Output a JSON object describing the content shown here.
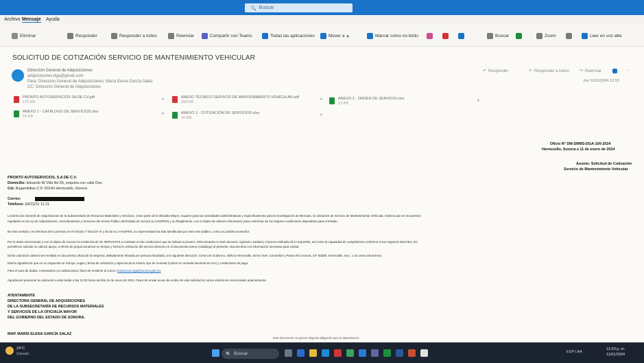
{
  "search": {
    "placeholder": "Buscar"
  },
  "menu": {
    "items": [
      "Archivo",
      "Mensaje",
      "Ayuda"
    ]
  },
  "toolbar": {
    "buttons": [
      "Eliminar",
      "Responder",
      "Responder a todos",
      "Reenviar",
      "Compartir con Teams",
      "Todas las aplicaciones",
      "Mover a",
      "Marcar como no leído",
      "Buscar",
      "Zoom",
      "Leer en voz alta"
    ]
  },
  "message": {
    "subject": "SOLICITUD DE COTIZACIÓN SERVICIO DE MANTENIMIENTO VEHICULAR",
    "from": "Dirección General de Adquisiciones",
    "from_email": "adquisiciones.dga@gmail.com",
    "to_line": "Para: Dirección General de Adquisiciones; María Elena García Salaz",
    "cc_line": "CC: Dirección General de Adquisiciones",
    "actions": [
      "Responder",
      "Responder a todos",
      "Reenviar"
    ],
    "date": "Jue 11/01/2024 12:53"
  },
  "attachments": [
    {
      "name": "PRONTO AUTOSERVICIOS SA DE CV.pdf",
      "size": "170 KB",
      "color": "#d13438"
    },
    {
      "name": "ANEXO TÉCNICO SERVICIO DE MANTENIMIENTO VEHICULAR.pdf",
      "size": "293 KB",
      "color": "#d13438"
    },
    {
      "name": "ANEXO 2 - ORDEN DE SERVICIO.xlsx",
      "size": "13 KB",
      "color": "#1e8e3e"
    },
    {
      "name": "ANEXO 1 - CATÁLOGO DE SERVICIOS.xlsx",
      "size": "15 KB",
      "color": "#1e8e3e"
    },
    {
      "name": "ANEXO 3 - COTIZACIÓN DE SERVICIOS.xlsx",
      "size": "16 KB",
      "color": "#1e8e3e"
    }
  ],
  "letter": {
    "oficio": "Oficio N° DM-SRMS-DGA-100-2024",
    "lugar_fecha": "Hermosillo, Sonora a 11 de enero de 2024",
    "asunto_1": "Asunto: Solicitud de Cotización",
    "asunto_2": "Servicio de Mantenimiento Vehicular",
    "company": "PRONTO AUTOSERVICIOS, S.A DE C.V.",
    "domicilio_label": "Domicilio:",
    "domicilio": "Eduardo W Villa No 55, esquina con calle Dos",
    "colonia_label": "Col.",
    "colonia": "Bugambilias C.P. 83140 Hermosillo, Sonora",
    "correo_label": "Correo:",
    "telefono_label": "Teléfono:",
    "telefono": "(662)211 11 21",
    "p1": "La Dirección General de Adquisiciones de la Subsecretaría de Recursos Materiales y Servicios, como parte de la Oficialía Mayor, requiere para sus actividades administrativas y específicamente para la Investigación de Mercado, la cotización de Servicio de Mantenimiento Vehicular, mismos que se encuentran",
    "p1b": "regulados en la Ley de Adquisiciones, Arrendamientos y Servicios del Sector Público del Estado de Sonora (LAASSPES) y su Reglamento, con el objeto de obtener información para conformar de los mejores condiciones disponibles para el Estado.",
    "p2": "En este sentido y en términos de lo previsto en el Artículo 7 fracción VI y 35 de la LAASSPES, su representada ha sido identificada por este ente público, como un posible proveedor.",
    "p3": "Por lo antes mencionado y con el objeto de conocer la existencia de los SERVICIOS a contratar en las condiciones que se indican a proveer, seleccionados a nivel nacional, regional o estatal y el precio estimado de lo requerido, así como la capacidad de cumplimiento conforme a sus negocios descritos, les",
    "p3b": "permitimos solicitar su valioso apoyo, a efecto de proporcionarnos en tiempo y forma la cotización del servicio descrito en el documento anexo (Catálogo) al presente, documentos con información necesaria para cotizar.",
    "p4": "Dicha cotización deberá ser remitida en documento oficial de la empresa, debidamente firmada por persona facultada, a la siguiente dirección: Centro de Gobierno, edificio Hermosillo, tercer nivel, Comonfort y Paseo Río Sonora, CP. 83280, Hermosillo, Son., o al correo electrónico.",
    "p5": "Mucho agradeceré que en su respuesta se incluya: Lugar y fecha de cotización y vigencia de la misma, tipo de moneda (cotizar en moneda nacional sin IVA) y condiciones de pago.",
    "p6": "Para el caso de dudas, comentarios y/o aclaraciones, favor de remitirse al correo:",
    "p6_email": "licitaciones.dga@sonora.gob.mx",
    "p7": "Agradeceré presentar la cotización a más tardar a las 12:00 horas del día 15 de enero de 2024. Favor de enviar acuse de recibo de esta solicitud al correo electrónico mencionado anteriormente.",
    "sig1": "ATENTAMENTE",
    "sig2": "DIRECTORA GENERAL DE ADQUISICIONES",
    "sig3": "DE LA SUBSECRETARÍA DE RECURSOS MATERIALES",
    "sig4": "Y SERVICIOS DE LA OFICIALÍA MAYOR",
    "sig5": "DEL GOBIERNO DEL ESTADO DE SONORA.",
    "sig6": "MAP. MARÍA ELENA GARCÍA SALAZ",
    "footer": "Este documento no genera ninguna obligación para la dependencia"
  },
  "taskbar": {
    "weather_temp": "24°C",
    "weather_desc": "Soleado",
    "search_placeholder": "Buscar",
    "language": "ESP LAA",
    "time": "12:53 p. m.",
    "date": "11/01/2024"
  },
  "colors": {
    "accent": "#1a73c8",
    "taskbar": "#1b2330"
  }
}
